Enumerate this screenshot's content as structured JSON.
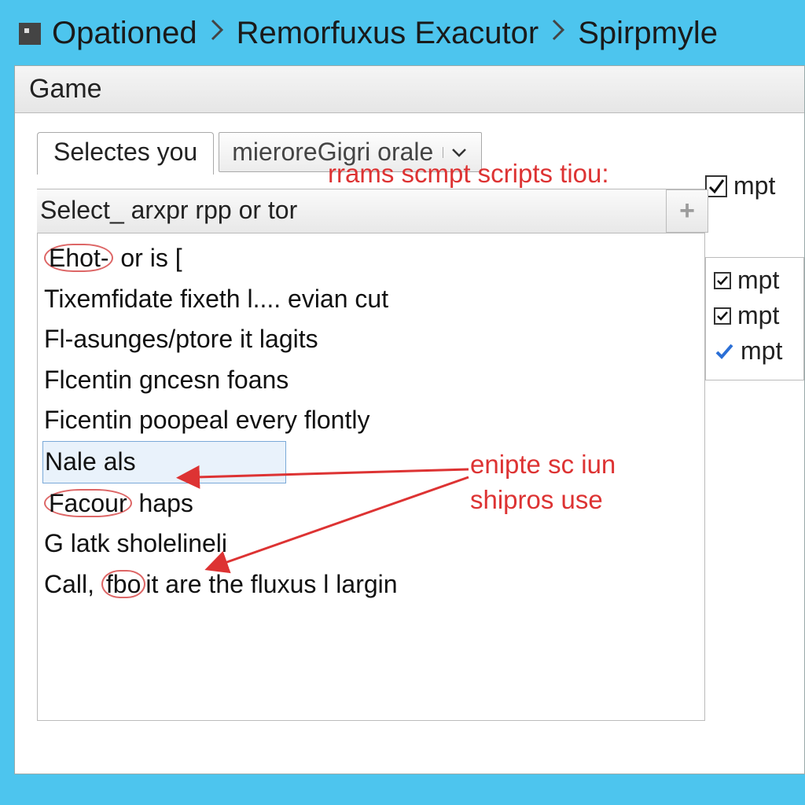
{
  "titlebar": {
    "crumbs": [
      "Opationed",
      "Remorfuxus Exacutor",
      "Spirpmyle"
    ]
  },
  "menubar": {
    "game": "Game"
  },
  "tabs": {
    "tab_label": "Selectes you",
    "dropdown_value": "mieroreGigri orale"
  },
  "annotations": {
    "top_red": "rrams scmpt scripts tiou:",
    "mid_red_line1": "enipte sc iun",
    "mid_red_line2": "shipros use"
  },
  "list": {
    "header": "Select_ arxpr rpp or tor",
    "items": [
      {
        "pre": "Ehot-",
        "rest": " or is ["
      },
      {
        "pre": "",
        "rest": "Tixemfidate fixeth l.... evian cut"
      },
      {
        "pre": "",
        "rest": "Fl-asunges/ptore it lagits"
      },
      {
        "pre": "",
        "rest": "Flcentin gncesn foans"
      },
      {
        "pre": "",
        "rest": "Ficentin poopeal every flontly"
      },
      {
        "pre": "",
        "rest": "Nale als"
      },
      {
        "pre": "Facour",
        "rest": " haps"
      },
      {
        "pre": "",
        "rest": "G latk sholelineli"
      },
      {
        "pre": "",
        "rest": "Call, ",
        "mid": "fbo",
        "post": "it are the fluxus l largin"
      }
    ]
  },
  "side": {
    "top_label": "mpt",
    "panel": [
      {
        "type": "box",
        "label": "mpt"
      },
      {
        "type": "box",
        "label": "mpt"
      },
      {
        "type": "blue",
        "label": "mpt"
      }
    ]
  }
}
